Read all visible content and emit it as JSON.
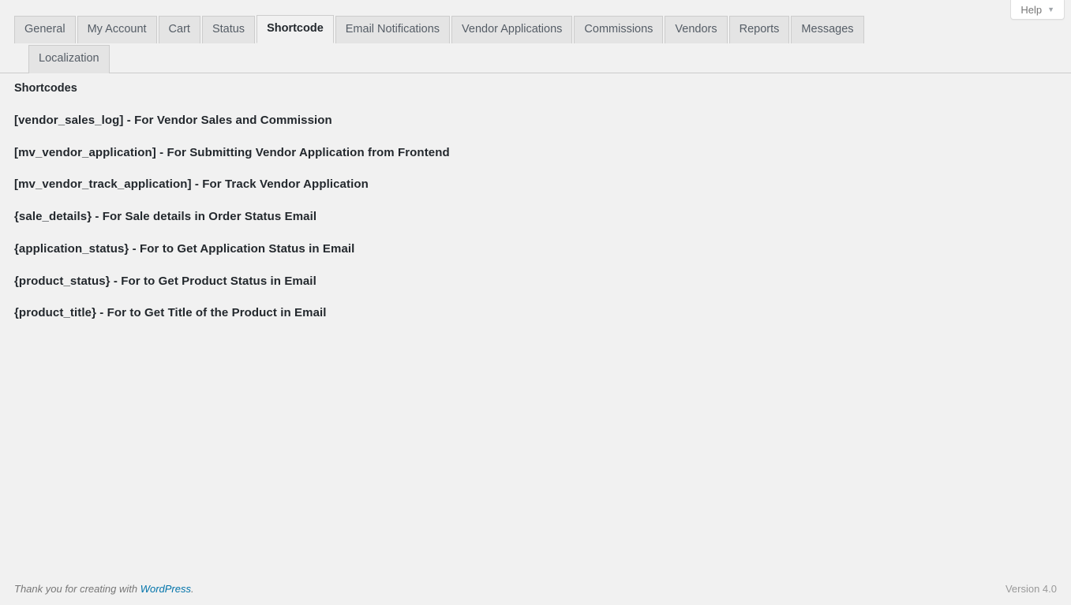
{
  "help": {
    "label": "Help",
    "caret_icon": "chevron-down-icon"
  },
  "tabs": {
    "row1": [
      {
        "label": "General",
        "active": false
      },
      {
        "label": "My Account",
        "active": false
      },
      {
        "label": "Cart",
        "active": false
      },
      {
        "label": "Status",
        "active": false
      },
      {
        "label": "Shortcode",
        "active": true
      },
      {
        "label": "Email Notifications",
        "active": false
      },
      {
        "label": "Vendor Applications",
        "active": false
      },
      {
        "label": "Commissions",
        "active": false
      },
      {
        "label": "Vendors",
        "active": false
      },
      {
        "label": "Reports",
        "active": false
      },
      {
        "label": "Messages",
        "active": false
      }
    ],
    "row2": [
      {
        "label": "Localization",
        "active": false
      }
    ]
  },
  "main": {
    "heading": "Shortcodes",
    "shortcodes": [
      "[vendor_sales_log] - For Vendor Sales and Commission",
      "[mv_vendor_application] - For Submitting Vendor Application from Frontend",
      "[mv_vendor_track_application] - For Track Vendor Application",
      "{sale_details} - For Sale details in Order Status Email",
      "{application_status} - For to Get Application Status in Email",
      "{product_status} - For to Get Product Status in Email",
      "{product_title} - For to Get Title of the Product in Email"
    ]
  },
  "footer": {
    "thanks_prefix": "Thank you for creating with ",
    "wordpress_link": "WordPress",
    "thanks_suffix": ".",
    "version": "Version 4.0"
  },
  "colors": {
    "page_bg": "#f1f1f1",
    "tab_inactive_bg": "#e4e4e4",
    "tab_border": "#cccccc",
    "text_dark": "#23282d",
    "text_muted": "#555d66",
    "link": "#0073aa"
  }
}
